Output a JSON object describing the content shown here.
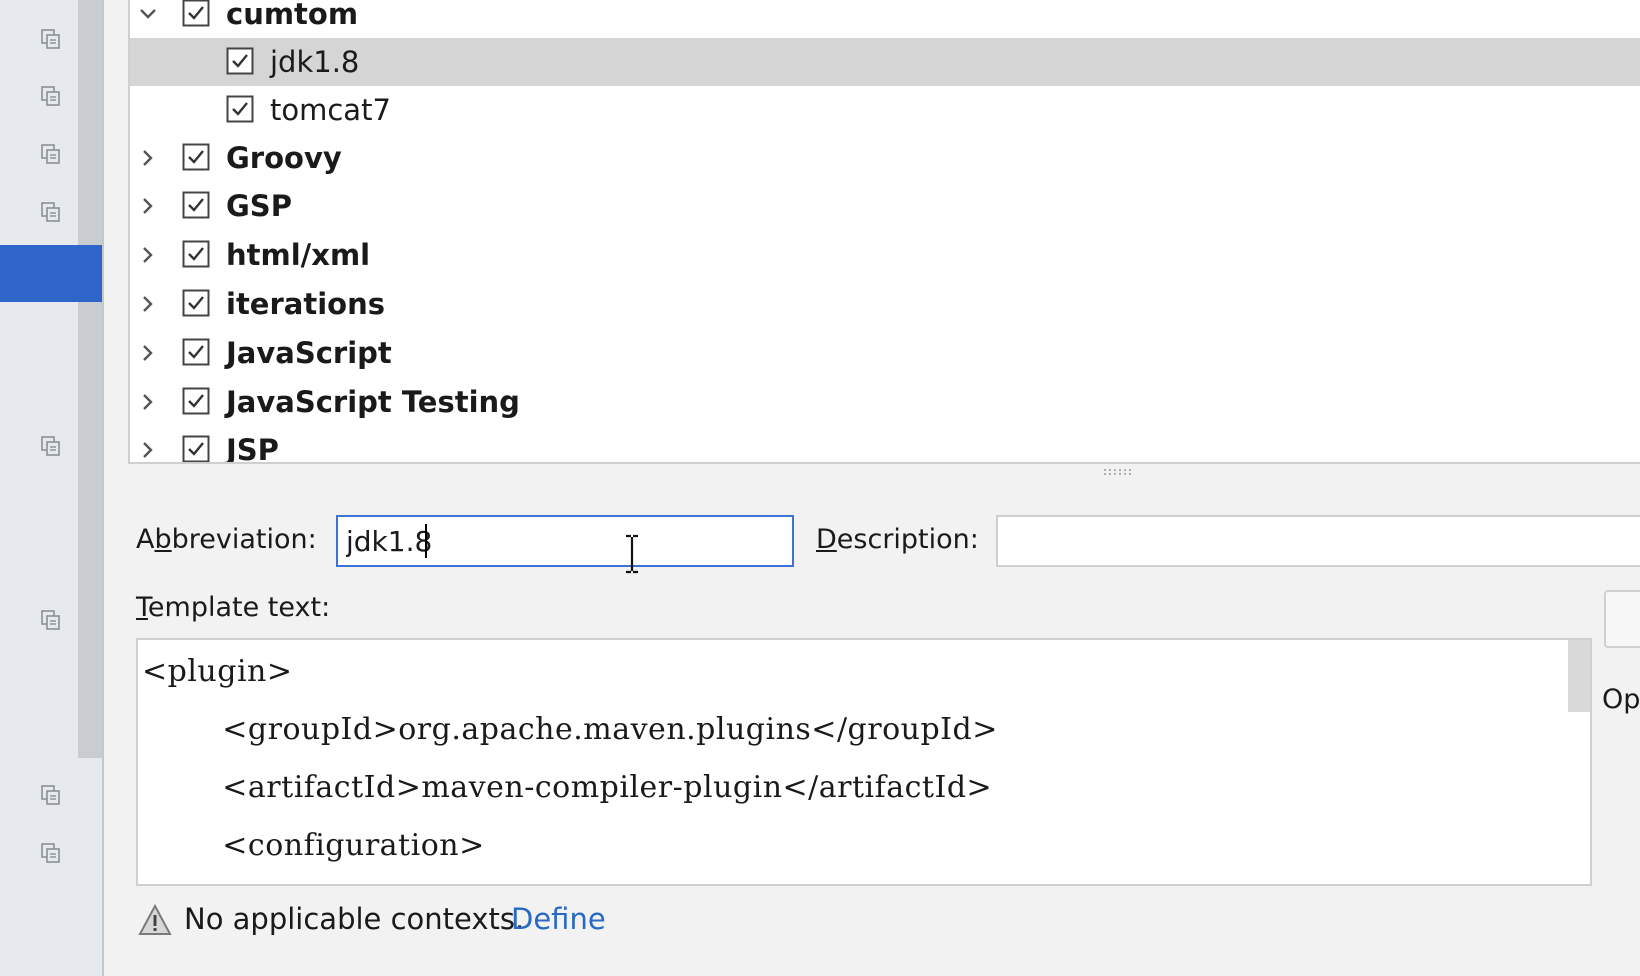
{
  "tree": {
    "rows": [
      {
        "label": "cumtom",
        "bold": true,
        "expanded": true,
        "level": 0
      },
      {
        "label": "jdk1.8",
        "bold": false,
        "level": 1,
        "selected": true
      },
      {
        "label": "tomcat7",
        "bold": false,
        "level": 1
      },
      {
        "label": "Groovy",
        "bold": true,
        "expanded": false,
        "level": 0
      },
      {
        "label": "GSP",
        "bold": true,
        "expanded": false,
        "level": 0
      },
      {
        "label": "html/xml",
        "bold": true,
        "expanded": false,
        "level": 0
      },
      {
        "label": "iterations",
        "bold": true,
        "expanded": false,
        "level": 0
      },
      {
        "label": "JavaScript",
        "bold": true,
        "expanded": false,
        "level": 0
      },
      {
        "label": "JavaScript Testing",
        "bold": true,
        "expanded": false,
        "level": 0
      },
      {
        "label": "JSP",
        "bold": true,
        "expanded": false,
        "level": 0
      }
    ]
  },
  "form": {
    "abbreviation_label_pre": "A",
    "abbreviation_label_mnemonic": "b",
    "abbreviation_label_post": "breviation:",
    "abbreviation_value": "jdk1.8",
    "description_label_mnemonic": "D",
    "description_label_post": "escription:",
    "description_value": "",
    "template_label_mnemonic": "T",
    "template_label_post": "emplate text:",
    "template_lines": [
      "<plugin>",
      "        <groupId>org.apache.maven.plugins</groupId>",
      "        <artifactId>maven-compiler-plugin</artifactId>",
      "        <configuration>"
    ],
    "side_text": "Op"
  },
  "status": {
    "message": "No applicable contexts.",
    "link": "Define"
  },
  "colors": {
    "accent": "#2f65ca",
    "link": "#2769c4",
    "selected_row": "#d5d5d5"
  }
}
